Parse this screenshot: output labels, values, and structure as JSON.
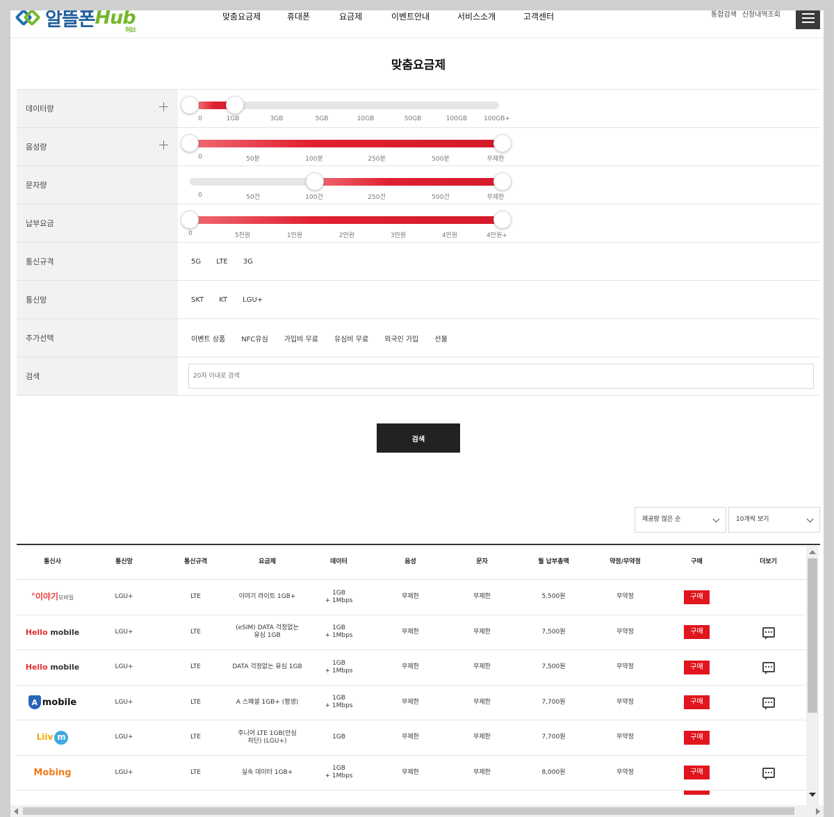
{
  "header": {
    "logo_text": "알뜰폰",
    "logo_hub": "Hub",
    "logo_sub": "허브",
    "nav": [
      "맞춤요금제",
      "휴대폰",
      "요금제",
      "이벤트안내",
      "서비스소개",
      "고객센터"
    ],
    "util": [
      "통합검색",
      "신청내역조회"
    ]
  },
  "page_title": "맞춤요금제",
  "filters": {
    "data": {
      "label": "데이터량",
      "ticks": [
        "0",
        "1GB",
        "3GB",
        "5GB",
        "10GB",
        "50GB",
        "100GB",
        "100GB+"
      ],
      "range": [
        "0",
        "1GB"
      ]
    },
    "voice": {
      "label": "음성량",
      "ticks": [
        "0",
        "50분",
        "100분",
        "250분",
        "500분",
        "무제한"
      ],
      "range": [
        "0",
        "무제한"
      ]
    },
    "sms": {
      "label": "문자량",
      "ticks": [
        "0",
        "50건",
        "100건",
        "250건",
        "500건",
        "무제한"
      ],
      "range": [
        "100건",
        "무제한"
      ]
    },
    "fee": {
      "label": "납부요금",
      "ticks": [
        "0",
        "5천원",
        "1만원",
        "2만원",
        "3만원",
        "4만원",
        "4만원+"
      ],
      "range": [
        "0",
        "4만원+"
      ]
    },
    "network_type": {
      "label": "통신규격",
      "options": [
        "5G",
        "LTE",
        "3G"
      ]
    },
    "carrier": {
      "label": "통신망",
      "options": [
        "SKT",
        "KT",
        "LGU+"
      ]
    },
    "extra": {
      "label": "추가선택",
      "options": [
        "이벤트 상품",
        "NFC유심",
        "가입비 무료",
        "유심비 무료",
        "외국인 가입",
        "선불"
      ]
    },
    "search": {
      "label": "검색",
      "placeholder": "20자 이내로 검색"
    }
  },
  "search_button": "검색",
  "sort": {
    "order": "제공량 많은 순",
    "per_page": "10개씩 보기"
  },
  "table": {
    "headers": [
      "통신사",
      "통신망",
      "통신규격",
      "요금제",
      "데이터",
      "음성",
      "문자",
      "월 납부총액",
      "약정/무약정",
      "구매",
      "더보기"
    ],
    "buy_label": "구매",
    "rows": [
      {
        "brand": "이야기",
        "brand_sub": "모바일",
        "brand_prefix": "°",
        "net": "LGU+",
        "spec": "LTE",
        "plan": "이야기 라이트 1GB+",
        "data1": "1GB",
        "data2": "+ 1Mbps",
        "voice": "무제한",
        "sms": "무제한",
        "price": "5,500원",
        "contract": "무약정",
        "more": false
      },
      {
        "brand": "Hello",
        "brand_sub": " mobile",
        "net": "LGU+",
        "spec": "LTE",
        "plan": "(eSIM) DATA 걱정없는 유심 1GB",
        "data1": "1GB",
        "data2": "+ 1Mbps",
        "voice": "무제한",
        "sms": "무제한",
        "price": "7,500원",
        "contract": "무약정",
        "more": true
      },
      {
        "brand": "Hello",
        "brand_sub": " mobile",
        "net": "LGU+",
        "spec": "LTE",
        "plan": "DATA 걱정없는 유심 1GB",
        "data1": "1GB",
        "data2": "+ 1Mbps",
        "voice": "무제한",
        "sms": "무제한",
        "price": "7,500원",
        "contract": "무약정",
        "more": true
      },
      {
        "brand": "A",
        "brand_sub": "mobile",
        "net": "LGU+",
        "spec": "LTE",
        "plan": "A 스페셜 1GB+ (평생)",
        "data1": "1GB",
        "data2": "+ 1Mbps",
        "voice": "무제한",
        "sms": "무제한",
        "price": "7,700원",
        "contract": "무약정",
        "more": true
      },
      {
        "brand": "Liiv",
        "brand_sub": "m",
        "net": "LGU+",
        "spec": "LTE",
        "plan": "주니어 LTE 1GB(안심차단) (LGU+)",
        "data1": "1GB",
        "data2": "",
        "voice": "무제한",
        "sms": "무제한",
        "price": "7,700원",
        "contract": "무약정",
        "more": false
      },
      {
        "brand": "Mobing",
        "brand_sub": "",
        "net": "LGU+",
        "spec": "LTE",
        "plan": "실속 데이터 1GB+",
        "data1": "1GB",
        "data2": "+ 1Mbps",
        "voice": "무제한",
        "sms": "무제한",
        "price": "8,000원",
        "contract": "무약정",
        "more": true
      }
    ]
  },
  "colors": {
    "accent": "#e0151e",
    "brand_blue": "#1f5e9b",
    "brand_green": "#75b72c",
    "dark": "#222222"
  }
}
